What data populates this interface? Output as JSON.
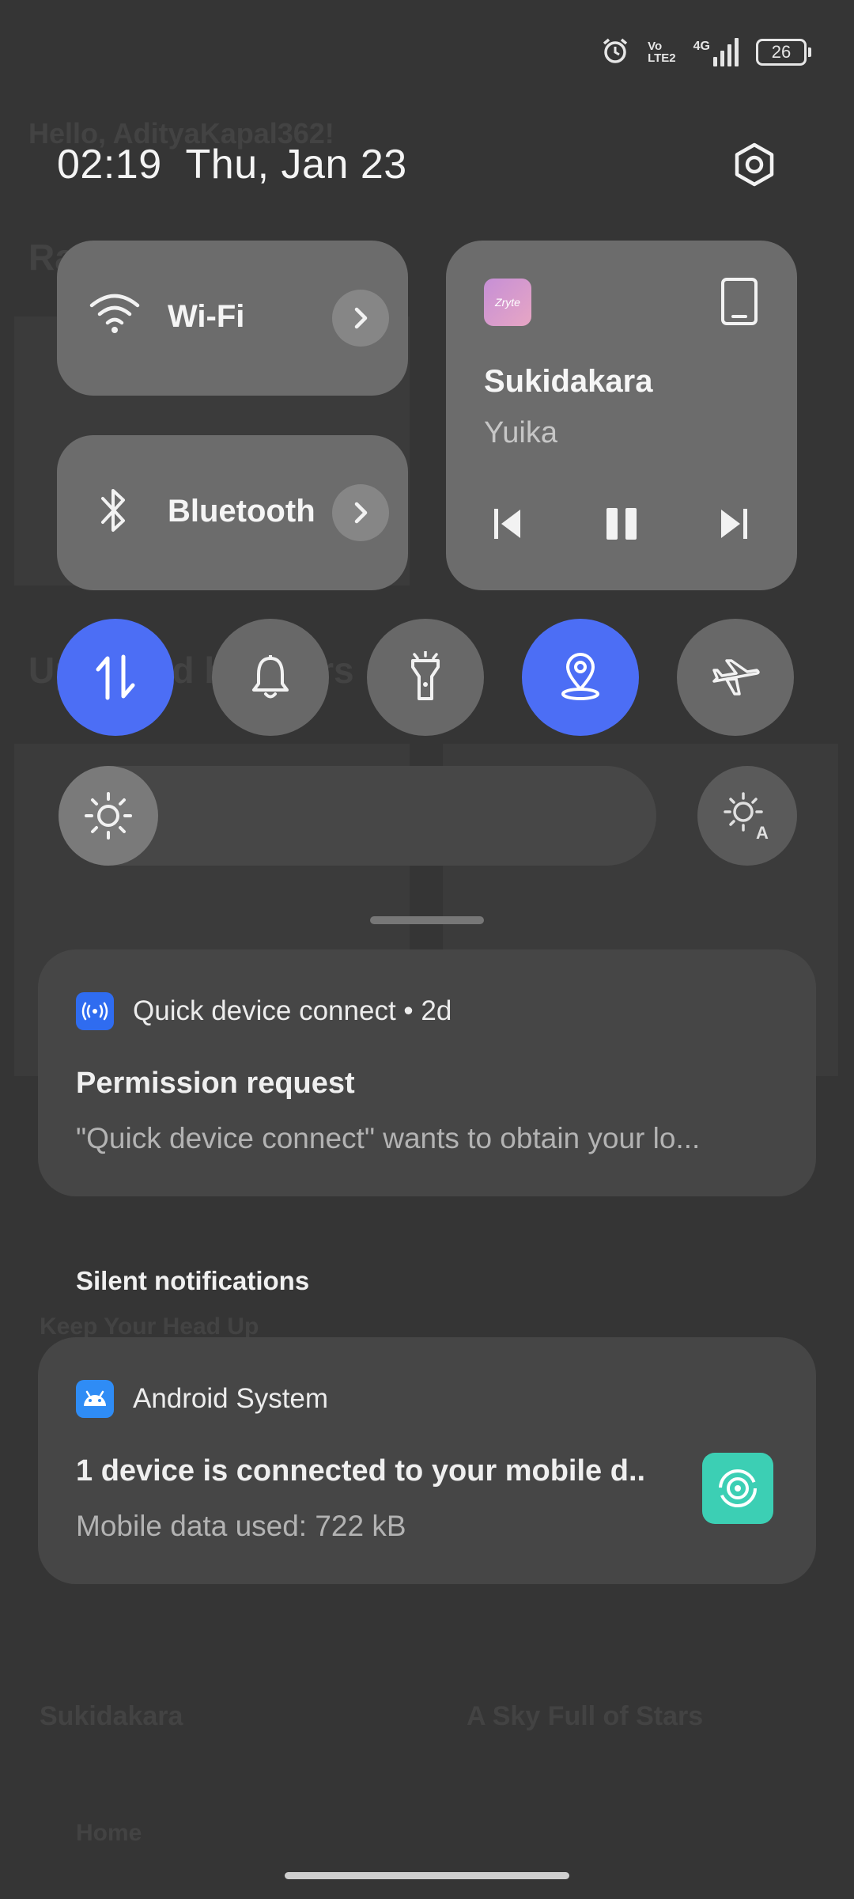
{
  "status_bar": {
    "volte_top": "Vo",
    "volte_bottom": "LTE2",
    "network": "4G",
    "battery": "26"
  },
  "header": {
    "time": "02:19",
    "date": "Thu, Jan 23"
  },
  "tiles": {
    "wifi_label": "Wi-Fi",
    "bluetooth_label": "Bluetooth"
  },
  "media": {
    "app_name": "Zryte",
    "title": "Sukidakara",
    "artist": "Yuika"
  },
  "toggles": [
    {
      "name": "mobile-data",
      "on": true
    },
    {
      "name": "sound",
      "on": false
    },
    {
      "name": "flashlight",
      "on": false
    },
    {
      "name": "location",
      "on": true
    },
    {
      "name": "airplane-mode",
      "on": false
    }
  ],
  "colors": {
    "active": "#4c6ef5",
    "tile": "#6c6c6c",
    "card": "#464646",
    "hotspot": "#3ccfb4",
    "quick_connect": "#2f6cf0",
    "android": "#2f8cf5"
  },
  "notifications": {
    "quick_connect": {
      "app": "Quick device connect",
      "time": "2d",
      "title": "Permission request",
      "body": "\"Quick device connect\" wants to obtain your lo..."
    },
    "silent_header": "Silent notifications",
    "android_system": {
      "app": "Android System",
      "title": "1 device is connected to your mobile d..",
      "body": "Mobile data used: 722 kB"
    }
  }
}
